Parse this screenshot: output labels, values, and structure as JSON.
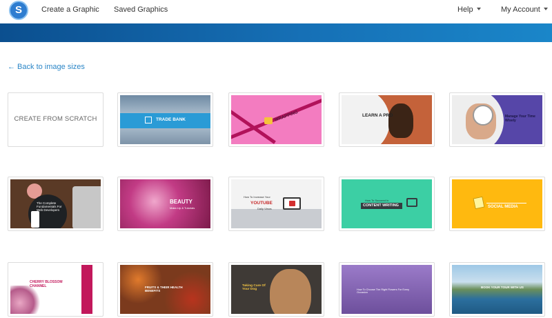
{
  "nav": {
    "logo_letter": "S",
    "create": "Create a Graphic",
    "saved": "Saved Graphics",
    "help": "Help",
    "account": "My Account"
  },
  "back_link": "← Back to image sizes",
  "templates": {
    "scratch": "CREATE FROM SCRATCH",
    "trade_bank": "TRADE BANK",
    "wrapping": "WRAPPING",
    "learn_pro": "LEARN A PRO",
    "manage_time": "Manage Your Time Wisely",
    "complete_fundamentals": "The Complete Fundamentals For Web Developers",
    "beauty": "BEAUTY",
    "beauty_sub": "Make-Up & Tutorials",
    "youtube_top": "How To Increase Your",
    "youtube": "YOUTUBE",
    "youtube_sub": "Daily Views",
    "content_top": "How To Succeed In",
    "content_writing": "CONTENT WRITING",
    "social_media": "SOCIAL MEDIA",
    "cherry_blossom": "CHERRY BLOSSOM CHANNEL",
    "fruits": "FRUITS & THEIR HEALTH BENEFITS",
    "taking_care": "Taking Care Of Your Dog",
    "choose_planet": "How To Choose The Right Flowers For Every Occasion",
    "book_tour": "BOOK YOUR TOUR WITH US"
  }
}
